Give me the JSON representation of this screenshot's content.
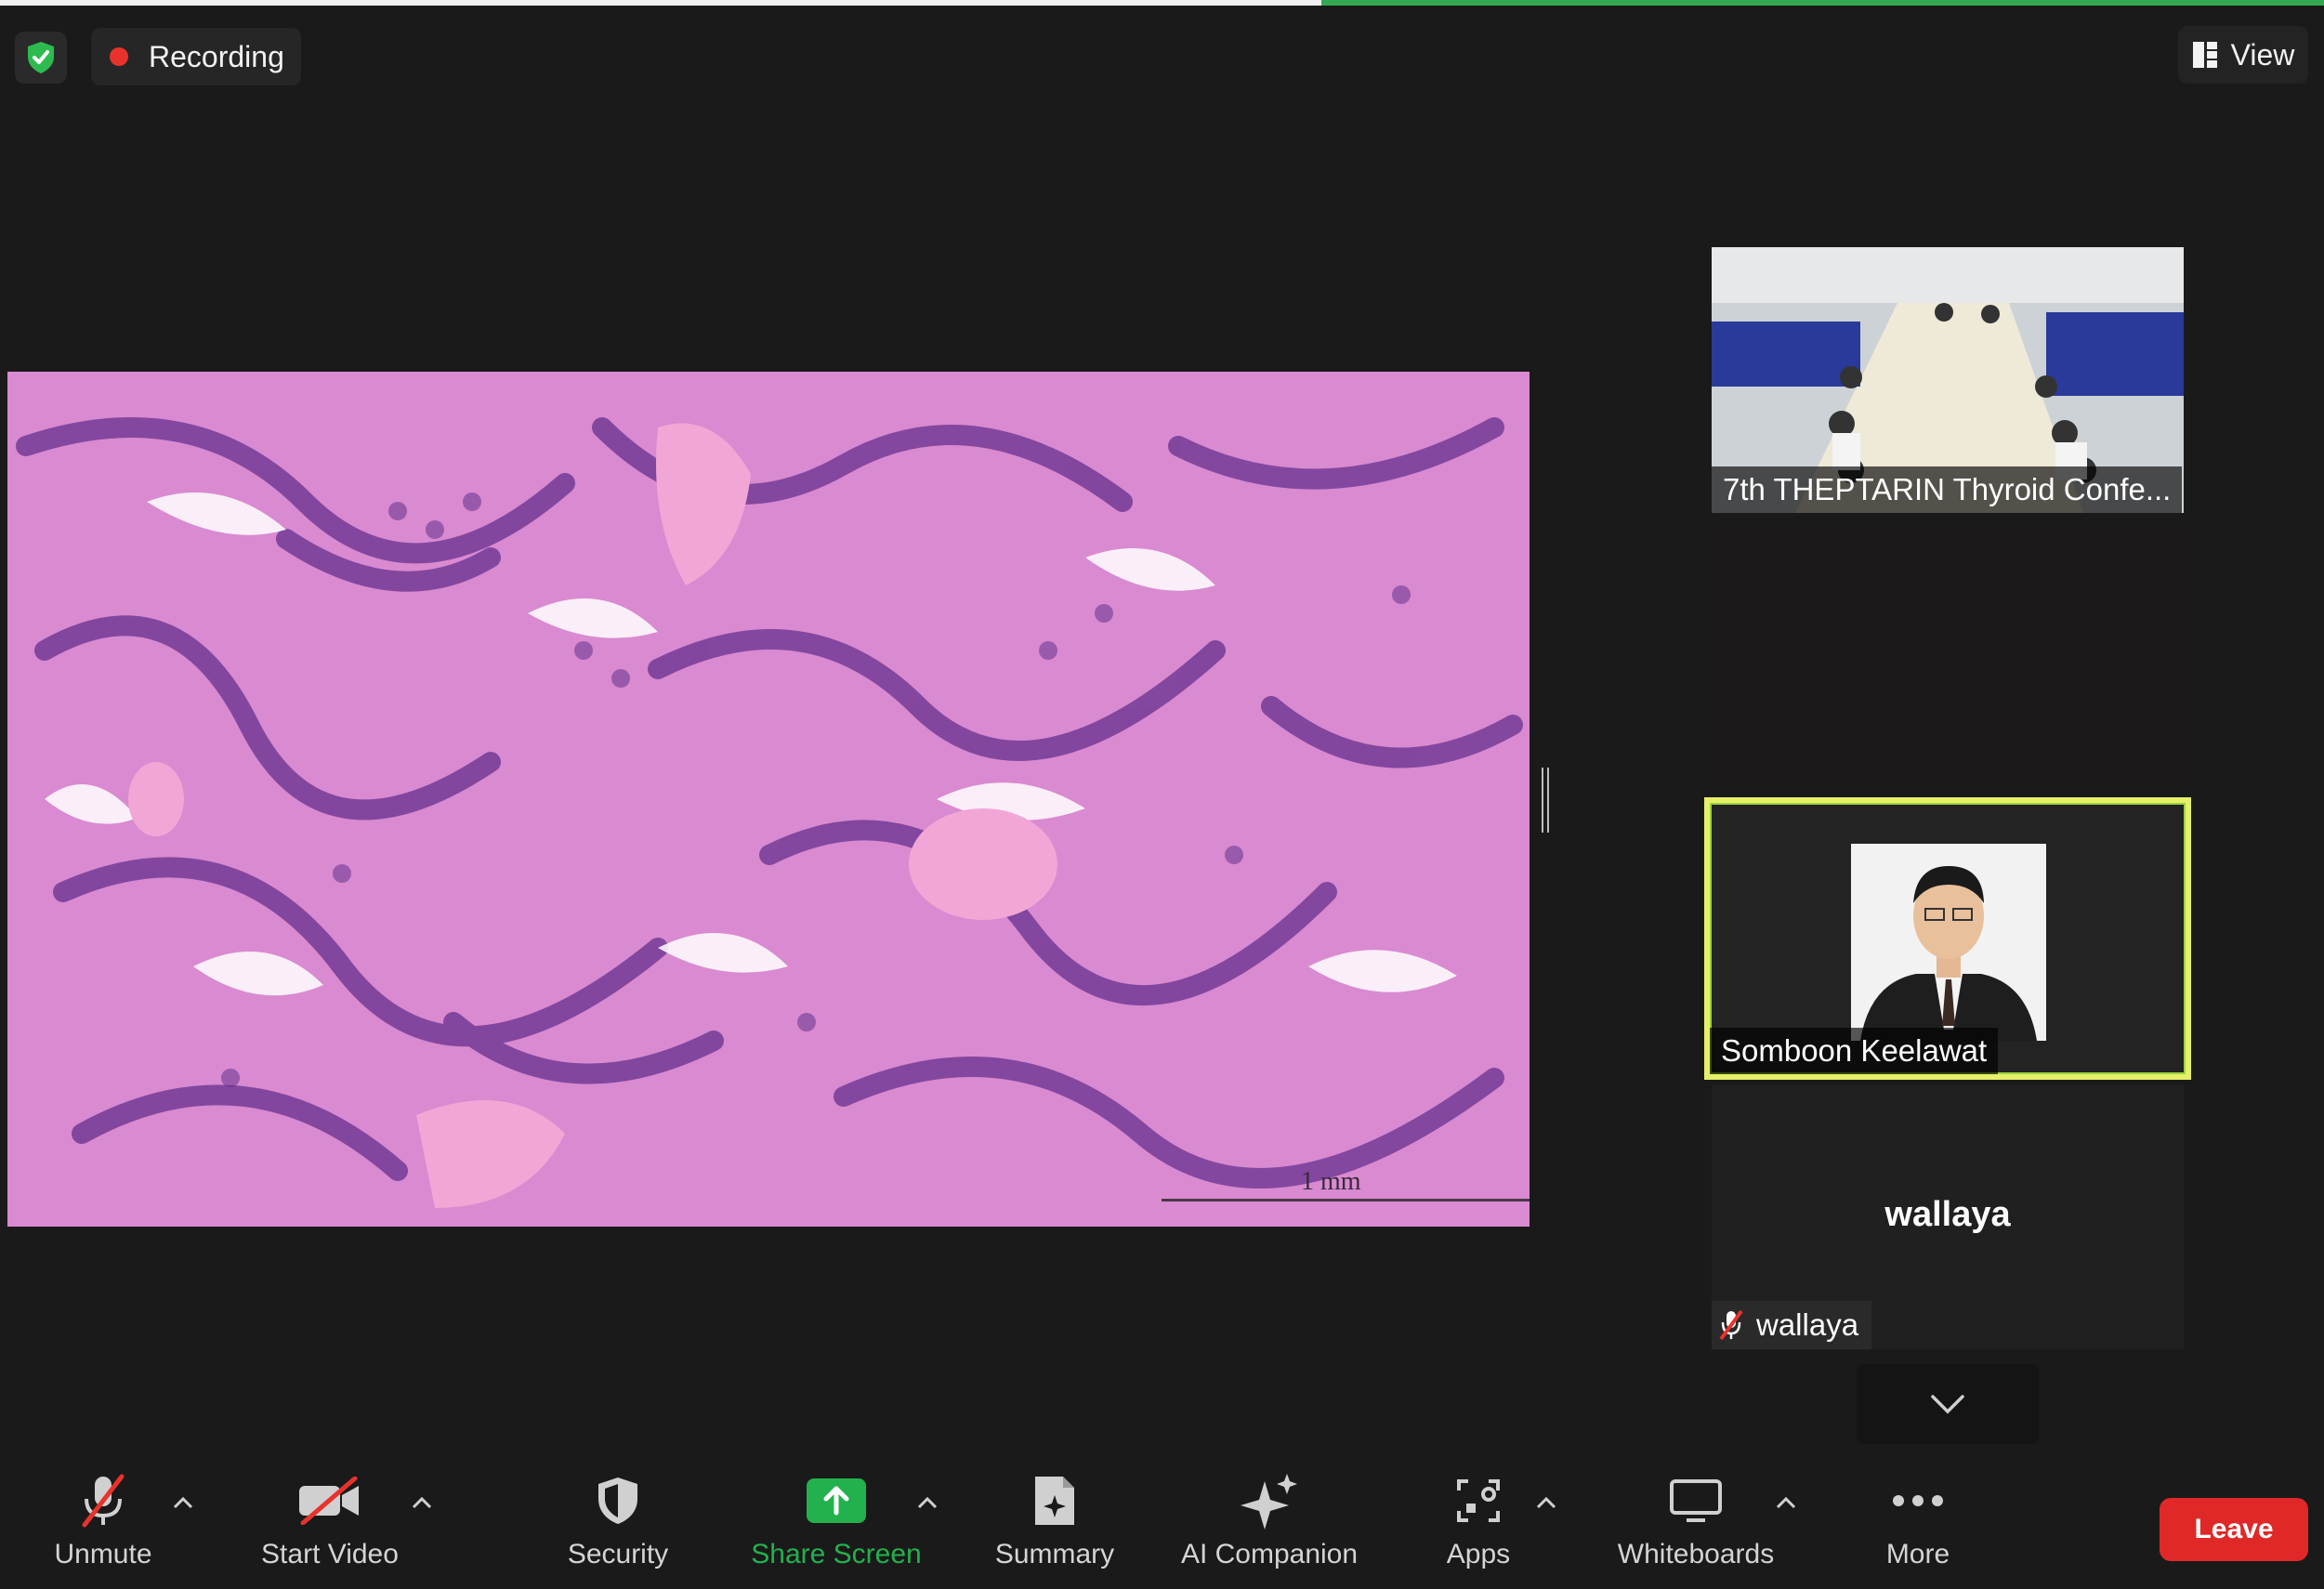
{
  "header": {
    "recording_label": "Recording",
    "view_label": "View"
  },
  "shared_content": {
    "scale_bar_label": "1 mm"
  },
  "participants": [
    {
      "name": "7th THEPTARIN Thyroid Confe..."
    },
    {
      "name": ""
    },
    {
      "name": "Somboon Keelawat",
      "active_speaker": true
    },
    {
      "name": "wallaya",
      "display_text": "wallaya",
      "muted": true
    }
  ],
  "toolbar": {
    "unmute": "Unmute",
    "start_video": "Start Video",
    "security": "Security",
    "share_screen": "Share Screen",
    "summary": "Summary",
    "ai_companion": "AI Companion",
    "apps": "Apps",
    "whiteboards": "Whiteboards",
    "more": "More",
    "leave": "Leave"
  },
  "icons": [
    "shield-check-icon",
    "recording-dot-icon",
    "view-grid-icon",
    "microphone-muted-icon",
    "video-off-icon",
    "security-shield-icon",
    "share-screen-arrow-icon",
    "summary-doc-icon",
    "sparkle-icon",
    "apps-icon",
    "whiteboard-icon",
    "more-dots-icon",
    "chevron-down-icon",
    "caret-up-icon"
  ],
  "colors": {
    "background": "#1a1a1a",
    "share_green": "#22b14c",
    "leave_red": "#e02828",
    "recording_red": "#e8322c",
    "speaker_border": "#e6f06a"
  }
}
